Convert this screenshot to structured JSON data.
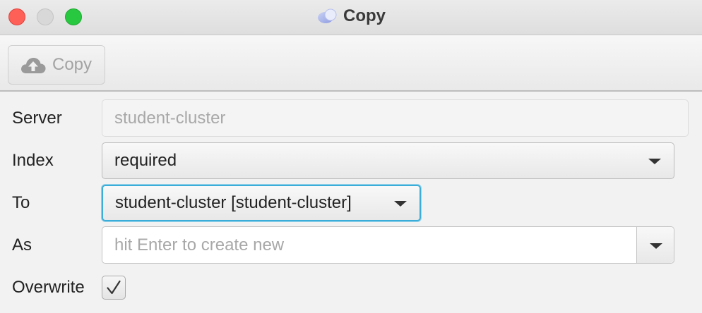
{
  "window": {
    "title": "Copy",
    "title_icon": "app-logo-icon",
    "controls": [
      "close-icon",
      "minimize-icon",
      "maximize-icon"
    ]
  },
  "toolbar": {
    "copy_label": "Copy",
    "copy_icon": "cloud-upload-icon",
    "copy_enabled": false
  },
  "form": {
    "server": {
      "label": "Server",
      "value": "student-cluster"
    },
    "index": {
      "label": "Index",
      "value": "required"
    },
    "to": {
      "label": "To",
      "value": "student-cluster [student-cluster]"
    },
    "as": {
      "label": "As",
      "value": "",
      "placeholder": "hit Enter to create new"
    },
    "overwrite": {
      "label": "Overwrite",
      "checked": true
    }
  },
  "colors": {
    "focus_border": "#3aaed8",
    "close": "#fe5f57",
    "maximize": "#28c840"
  }
}
